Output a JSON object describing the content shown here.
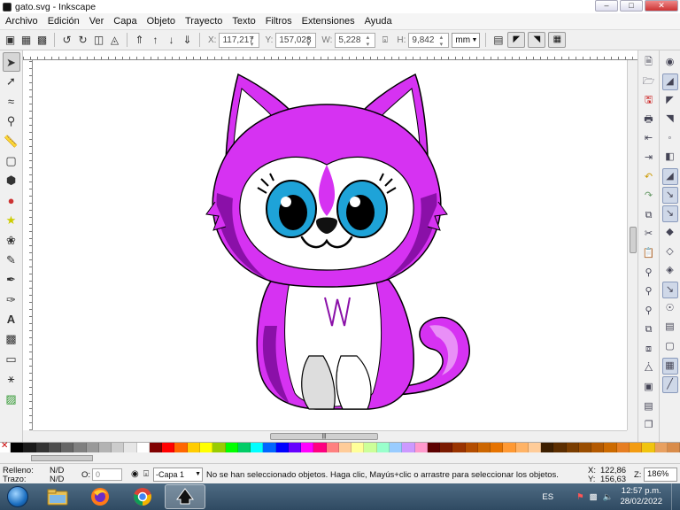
{
  "window": {
    "title": "gato.svg - Inkscape"
  },
  "menubar": {
    "items": [
      "Archivo",
      "Edición",
      "Ver",
      "Capa",
      "Objeto",
      "Trayecto",
      "Texto",
      "Filtros",
      "Extensiones",
      "Ayuda"
    ]
  },
  "toolbar": {
    "x_label": "X:",
    "x_value": "117,217",
    "y_label": "Y:",
    "y_value": "157,028",
    "w_label": "W:",
    "w_value": "5,228",
    "h_label": "H:",
    "h_value": "9,842",
    "unit": "mm"
  },
  "statusbar": {
    "fill_label": "Relleno:",
    "fill_value": "N/D",
    "stroke_label": "Trazo:",
    "stroke_value": "N/D",
    "opacity_label": "O:",
    "opacity_value": "0",
    "layer": "-Capa 1",
    "message": "No se han seleccionado objetos. Haga clic, Mayús+clic o arrastre para seleccionar los objetos.",
    "x_label": "X:",
    "x_value": "122,86",
    "y_label": "Y:",
    "y_value": "156,63",
    "zoom_label": "Z:",
    "zoom_value": "186%"
  },
  "taskbar": {
    "language": "ES",
    "time": "12:57 p.m.",
    "date": "28/02/2022"
  },
  "colors": {
    "purple_main": "#d632f2",
    "purple_dark": "#8a10a8",
    "purple_light": "#e98ff7",
    "eye_blue": "#1ea3d8",
    "accent_selection": "#cfd8e8"
  }
}
